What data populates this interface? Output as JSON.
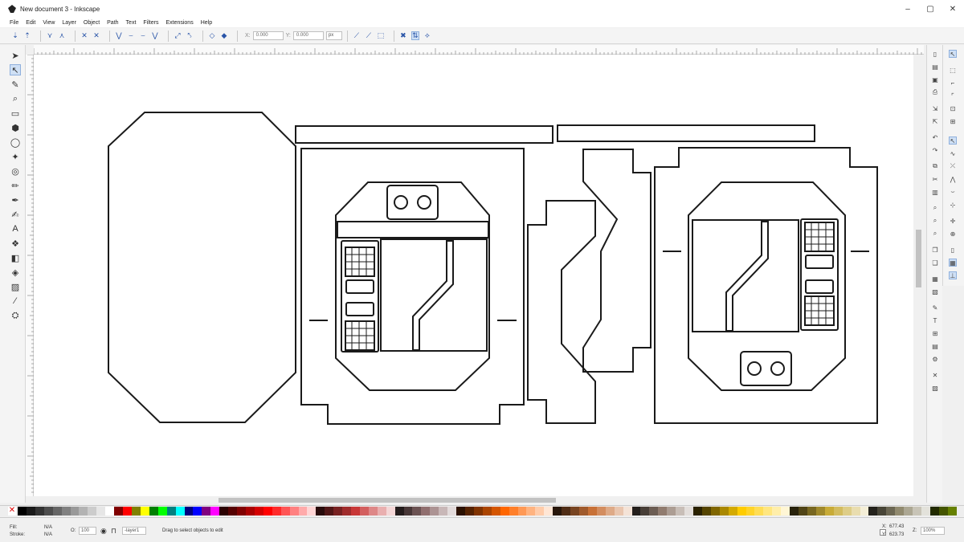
{
  "window": {
    "title": "New document 3 - Inkscape",
    "controls": {
      "minimize": "–",
      "maximize": "▢",
      "close": "✕"
    }
  },
  "menu": [
    "File",
    "Edit",
    "View",
    "Layer",
    "Object",
    "Path",
    "Text",
    "Filters",
    "Extensions",
    "Help"
  ],
  "node_toolbar": {
    "x_label": "X:",
    "x_value": "0.000",
    "y_label": "Y:",
    "y_value": "0.000",
    "unit": "px"
  },
  "statusbar": {
    "fill_label": "Fill:",
    "fill_value": "N/A",
    "stroke_label": "Stroke:",
    "stroke_value": "N/A",
    "opacity_label": "O:",
    "opacity_value": "100",
    "layer_value": "-layer1",
    "message": "Drag to select objects to edit",
    "x_label": "X:",
    "x_value": "677.43",
    "y_label": "Y:",
    "y_value": "623.73",
    "z_label": "Z:",
    "zoom_value": "100%"
  },
  "colors": {
    "accent": "#2a55a8",
    "canvas": "#ffffff",
    "stroke": "#1a1a1a"
  }
}
